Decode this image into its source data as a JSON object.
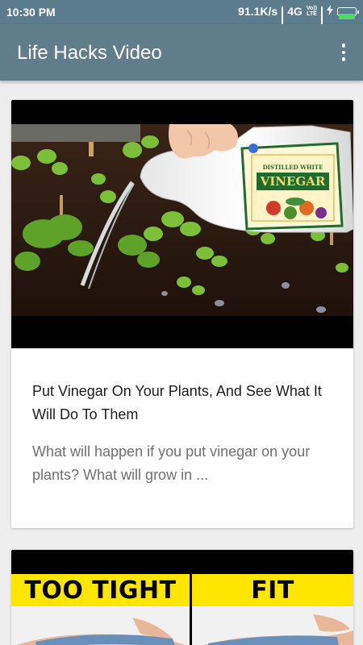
{
  "status_bar": {
    "time": "10:30 PM",
    "speed": "91.1K/s",
    "network": "4G",
    "volte_top": "Vo))",
    "volte_bottom": "LTE",
    "charging_icon": "bolt-icon",
    "battery_icon": "battery-icon"
  },
  "app_bar": {
    "title": "Life Hacks Video",
    "menu_icon": "more-vert-icon",
    "color": "#607d8b"
  },
  "cards": [
    {
      "title": "Put Vinegar On Your Plants, And See What It Will Do To Them",
      "description": "What will happen if you put vinegar on your plants? What will grow in ...",
      "bottle_label": "VINEGAR",
      "bottle_sublabel": "DISTILLED WHITE"
    },
    {
      "banner_left": "TOO TIGHT",
      "banner_right": "FIT",
      "banner_color": "#ffe600"
    }
  ]
}
